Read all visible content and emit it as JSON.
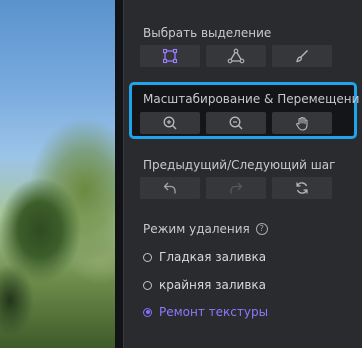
{
  "select": {
    "label": "Выбрать выделение",
    "buttons": [
      {
        "icon": "rectangle-select-icon"
      },
      {
        "icon": "polygon-select-icon"
      },
      {
        "icon": "brush-icon"
      }
    ]
  },
  "zoom": {
    "label": "Масштабирование & Перемещение",
    "buttons": [
      {
        "icon": "zoom-in-icon"
      },
      {
        "icon": "zoom-out-icon"
      },
      {
        "icon": "hand-icon"
      }
    ]
  },
  "history": {
    "label": "Предыдущий/Следующий шаг",
    "buttons": [
      {
        "icon": "undo-icon"
      },
      {
        "icon": "redo-icon"
      },
      {
        "icon": "reset-icon"
      }
    ]
  },
  "removal": {
    "label": "Режим удаления",
    "help": "?",
    "options": [
      {
        "label": "Гладкая заливка",
        "selected": false
      },
      {
        "label": "крайняя заливка",
        "selected": false
      },
      {
        "label": "Ремонт текстуры",
        "selected": true
      }
    ]
  },
  "colors": {
    "accent": "#8a6cff",
    "highlight": "#1fa3ea"
  }
}
